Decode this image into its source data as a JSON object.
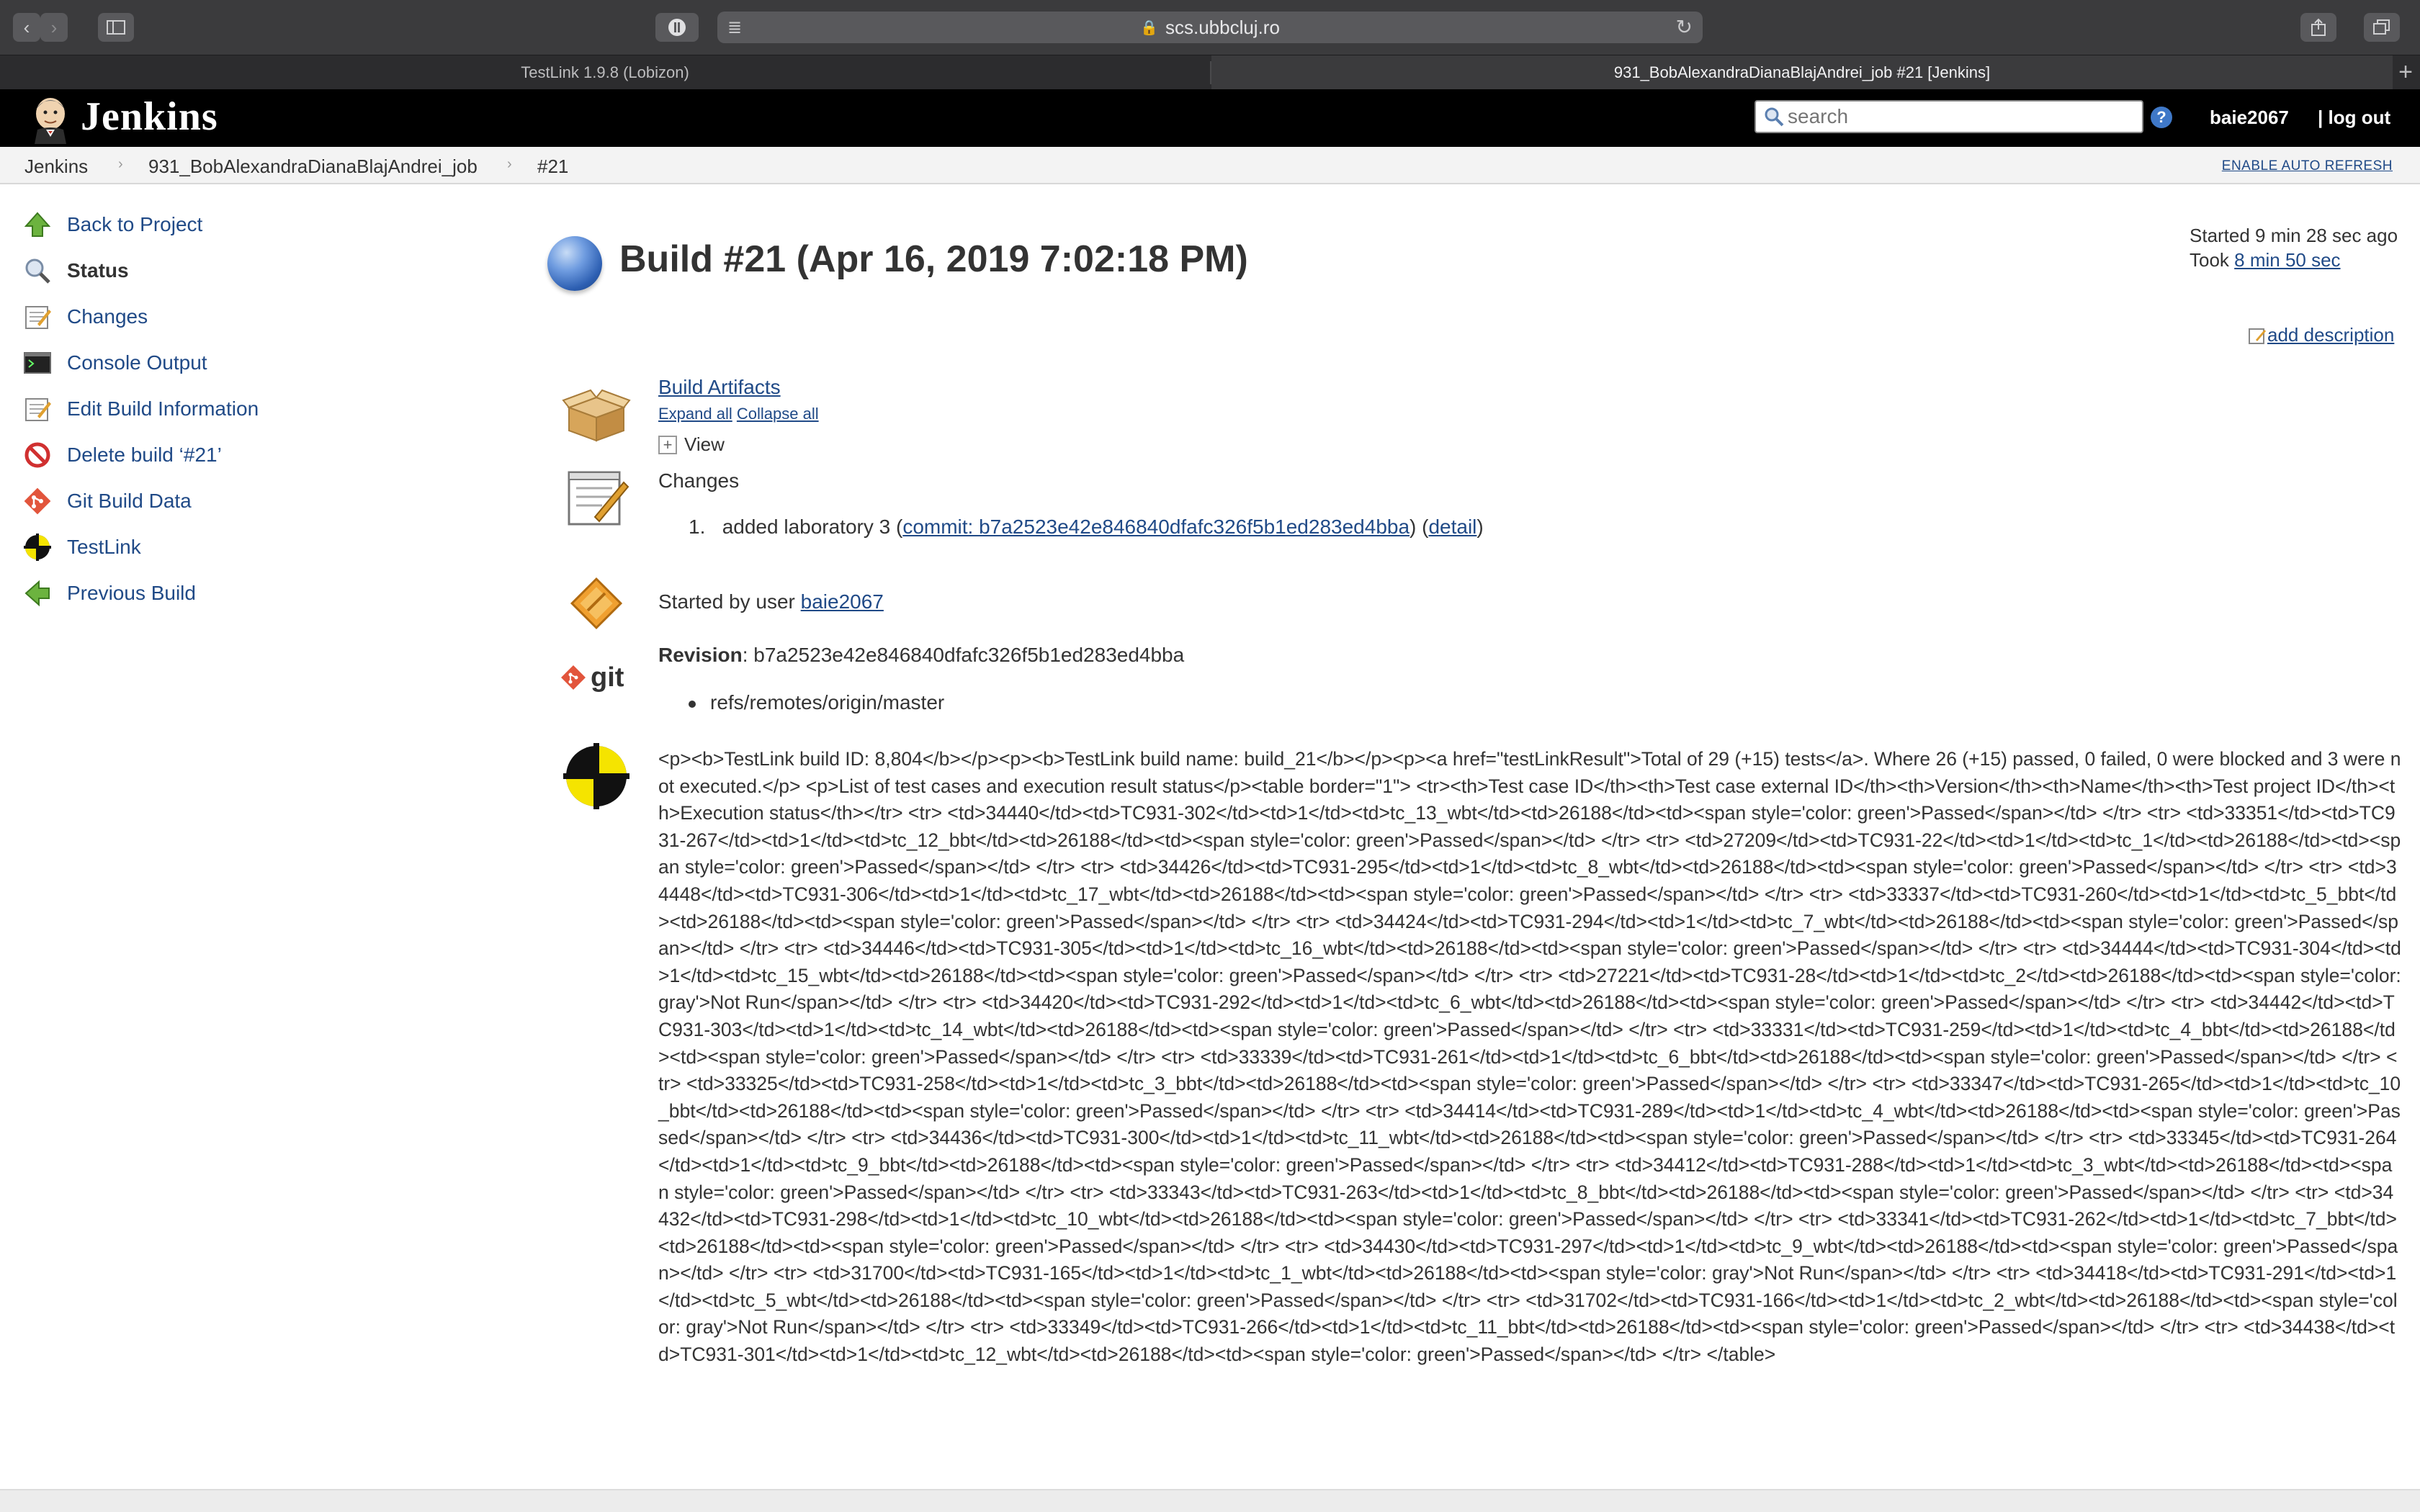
{
  "browser": {
    "url": "scs.ubbcluj.ro",
    "tabs": [
      {
        "title": "TestLink 1.9.8 (Lobizon)",
        "active": false
      },
      {
        "title": "931_BobAlexandraDianaBlajAndrei_job #21 [Jenkins]",
        "active": true
      }
    ]
  },
  "header": {
    "logo_text": "Jenkins",
    "search_placeholder": "search",
    "help": "?",
    "username": "baie2067",
    "logout": "| log out"
  },
  "breadcrumb": {
    "items": [
      "Jenkins",
      "931_BobAlexandraDianaBlajAndrei_job",
      "#21"
    ],
    "auto_refresh": "ENABLE AUTO REFRESH"
  },
  "sidebar": {
    "items": [
      {
        "label": "Back to Project",
        "icon": "up-arrow-icon"
      },
      {
        "label": "Status",
        "icon": "magnifier-icon"
      },
      {
        "label": "Changes",
        "icon": "notepad-icon"
      },
      {
        "label": "Console Output",
        "icon": "terminal-icon"
      },
      {
        "label": "Edit Build Information",
        "icon": "notepad-icon"
      },
      {
        "label": "Delete build ‘#21’",
        "icon": "no-entry-icon"
      },
      {
        "label": "Git Build Data",
        "icon": "git-icon"
      },
      {
        "label": "TestLink",
        "icon": "testlink-icon"
      },
      {
        "label": "Previous Build",
        "icon": "left-arrow-icon"
      }
    ]
  },
  "build": {
    "title": "Build #21 (Apr 16, 2019 7:02:18 PM)",
    "started": "Started 9 min 28 sec ago",
    "took_label": "Took ",
    "took_value": "8 min 50 sec",
    "add_description": "add description",
    "artifacts_title": "Build Artifacts",
    "expand_all": "Expand all",
    "collapse_all": "Collapse all",
    "view": "View",
    "changes_title": "Changes",
    "change_number": "1.",
    "change_text": "added laboratory 3 (",
    "change_commit": "commit: b7a2523e42e846840dfafc326f5b1ed283ed4bba",
    "change_mid": ") (",
    "change_detail": "detail",
    "change_end": ")",
    "started_by_prefix": "Started by user ",
    "started_by_user": "baie2067",
    "revision_label": "Revision",
    "revision_value": ": b7a2523e42e846840dfafc326f5b1ed283ed4bba",
    "branch": "refs/remotes/origin/master",
    "git_logo": "git",
    "testlink_raw": "<p><b>TestLink build ID: 8,804</b></p><p><b>TestLink build name: build_21</b></p><p><a href=\"testLinkResult\">Total of 29 (+15) tests</a>. Where 26 (+15) passed, 0 failed, 0 were blocked and 3 were not executed.</p> <p>List of test cases and execution result status</p><table border=\"1\"> <tr><th>Test case ID</th><th>Test case external ID</th><th>Version</th><th>Name</th><th>Test project ID</th><th>Execution status</th></tr> <tr> <td>34440</td><td>TC931-302</td><td>1</td><td>tc_13_wbt</td><td>26188</td><td><span style='color: green'>Passed</span></td> </tr> <tr> <td>33351</td><td>TC931-267</td><td>1</td><td>tc_12_bbt</td><td>26188</td><td><span style='color: green'>Passed</span></td> </tr> <tr> <td>27209</td><td>TC931-22</td><td>1</td><td>tc_1</td><td>26188</td><td><span style='color: green'>Passed</span></td> </tr> <tr> <td>34426</td><td>TC931-295</td><td>1</td><td>tc_8_wbt</td><td>26188</td><td><span style='color: green'>Passed</span></td> </tr> <tr> <td>34448</td><td>TC931-306</td><td>1</td><td>tc_17_wbt</td><td>26188</td><td><span style='color: green'>Passed</span></td> </tr> <tr> <td>33337</td><td>TC931-260</td><td>1</td><td>tc_5_bbt</td><td>26188</td><td><span style='color: green'>Passed</span></td> </tr> <tr> <td>34424</td><td>TC931-294</td><td>1</td><td>tc_7_wbt</td><td>26188</td><td><span style='color: green'>Passed</span></td> </tr> <tr> <td>34446</td><td>TC931-305</td><td>1</td><td>tc_16_wbt</td><td>26188</td><td><span style='color: green'>Passed</span></td> </tr> <tr> <td>34444</td><td>TC931-304</td><td>1</td><td>tc_15_wbt</td><td>26188</td><td><span style='color: green'>Passed</span></td> </tr> <tr> <td>27221</td><td>TC931-28</td><td>1</td><td>tc_2</td><td>26188</td><td><span style='color: gray'>Not Run</span></td> </tr> <tr> <td>34420</td><td>TC931-292</td><td>1</td><td>tc_6_wbt</td><td>26188</td><td><span style='color: green'>Passed</span></td> </tr> <tr> <td>34442</td><td>TC931-303</td><td>1</td><td>tc_14_wbt</td><td>26188</td><td><span style='color: green'>Passed</span></td> </tr> <tr> <td>33331</td><td>TC931-259</td><td>1</td><td>tc_4_bbt</td><td>26188</td><td><span style='color: green'>Passed</span></td> </tr> <tr> <td>33339</td><td>TC931-261</td><td>1</td><td>tc_6_bbt</td><td>26188</td><td><span style='color: green'>Passed</span></td> </tr> <tr> <td>33325</td><td>TC931-258</td><td>1</td><td>tc_3_bbt</td><td>26188</td><td><span style='color: green'>Passed</span></td> </tr> <tr> <td>33347</td><td>TC931-265</td><td>1</td><td>tc_10_bbt</td><td>26188</td><td><span style='color: green'>Passed</span></td> </tr> <tr> <td>34414</td><td>TC931-289</td><td>1</td><td>tc_4_wbt</td><td>26188</td><td><span style='color: green'>Passed</span></td> </tr> <tr> <td>34436</td><td>TC931-300</td><td>1</td><td>tc_11_wbt</td><td>26188</td><td><span style='color: green'>Passed</span></td> </tr> <tr> <td>33345</td><td>TC931-264</td><td>1</td><td>tc_9_bbt</td><td>26188</td><td><span style='color: green'>Passed</span></td> </tr> <tr> <td>34412</td><td>TC931-288</td><td>1</td><td>tc_3_wbt</td><td>26188</td><td><span style='color: green'>Passed</span></td> </tr> <tr> <td>33343</td><td>TC931-263</td><td>1</td><td>tc_8_bbt</td><td>26188</td><td><span style='color: green'>Passed</span></td> </tr> <tr> <td>34432</td><td>TC931-298</td><td>1</td><td>tc_10_wbt</td><td>26188</td><td><span style='color: green'>Passed</span></td> </tr> <tr> <td>33341</td><td>TC931-262</td><td>1</td><td>tc_7_bbt</td><td>26188</td><td><span style='color: green'>Passed</span></td> </tr> <tr> <td>34430</td><td>TC931-297</td><td>1</td><td>tc_9_wbt</td><td>26188</td><td><span style='color: green'>Passed</span></td> </tr> <tr> <td>31700</td><td>TC931-165</td><td>1</td><td>tc_1_wbt</td><td>26188</td><td><span style='color: gray'>Not Run</span></td> </tr> <tr> <td>34418</td><td>TC931-291</td><td>1</td><td>tc_5_wbt</td><td>26188</td><td><span style='color: green'>Passed</span></td> </tr> <tr> <td>31702</td><td>TC931-166</td><td>1</td><td>tc_2_wbt</td><td>26188</td><td><span style='color: gray'>Not Run</span></td> </tr> <tr> <td>33349</td><td>TC931-266</td><td>1</td><td>tc_11_bbt</td><td>26188</td><td><span style='color: green'>Passed</span></td> </tr> <tr> <td>34438</td><td>TC931-301</td><td>1</td><td>tc_12_wbt</td><td>26188</td><td><span style='color: green'>Passed</span></td> </tr> </table>"
  },
  "colors": {
    "link": "#204a87",
    "header_bg": "#000000",
    "build_ball": "#2d5fb2"
  }
}
